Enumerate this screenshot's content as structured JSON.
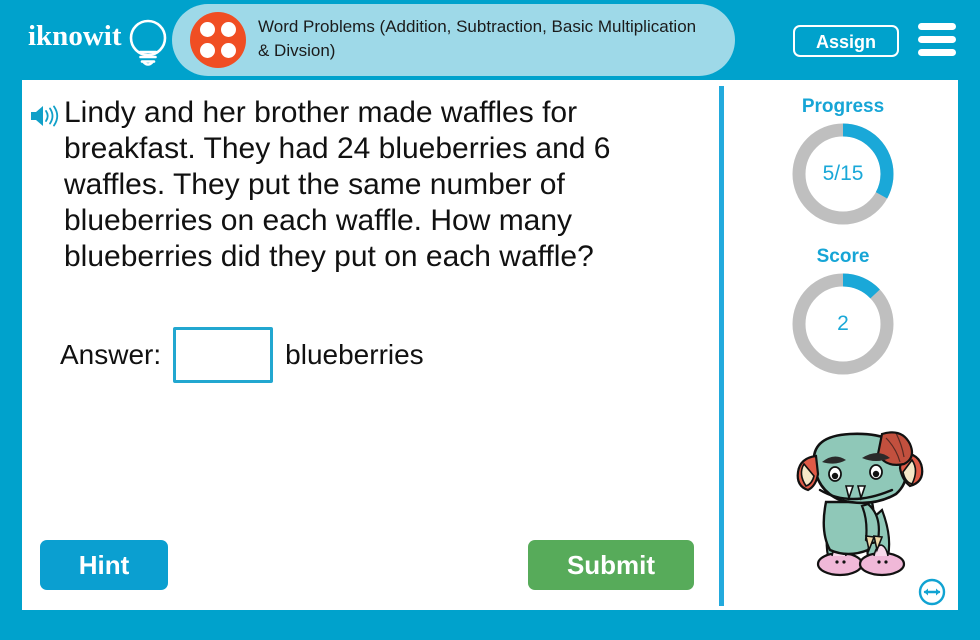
{
  "app": {
    "brand": "iknowit",
    "brand_icon": "lightbulb-icon"
  },
  "header": {
    "lesson_icon": "four-dot-circle-icon",
    "title": "Word Problems (Addition, Subtraction, Basic Multiplication & Divsion)",
    "assign_label": "Assign",
    "menu_icon": "hamburger-menu-icon",
    "background_color": "#00a2cc",
    "pill_color": "#9ed9e8",
    "dice_color": "#f04e23"
  },
  "question": {
    "audio_icon": "speaker-icon",
    "text": "Lindy and her brother made waffles for breakfast. They had 24 blueberries and 6 waffles. They put the same number of blueberries on each waffle. How many blueberries did they put on each waffle?",
    "answer_label": "Answer:",
    "answer_value": "",
    "answer_placeholder": "",
    "answer_unit": "blueberries"
  },
  "actions": {
    "hint_label": "Hint",
    "submit_label": "Submit",
    "hint_color": "#0b9fd0",
    "submit_color": "#57ab5a"
  },
  "sidebar": {
    "progress": {
      "label": "Progress",
      "value_text": "5/15",
      "current": 5,
      "total": 15,
      "percent": 33,
      "arc_color": "#1aa8d8",
      "track_color": "#bfbfbf"
    },
    "score": {
      "label": "Score",
      "value_text": "2",
      "current": 2,
      "total": 15,
      "percent": 13,
      "arc_color": "#1aa8d8",
      "track_color": "#bfbfbf"
    },
    "mascot_icon": "green-monster-mascot",
    "resize_icon": "resize-horizontal-icon"
  }
}
